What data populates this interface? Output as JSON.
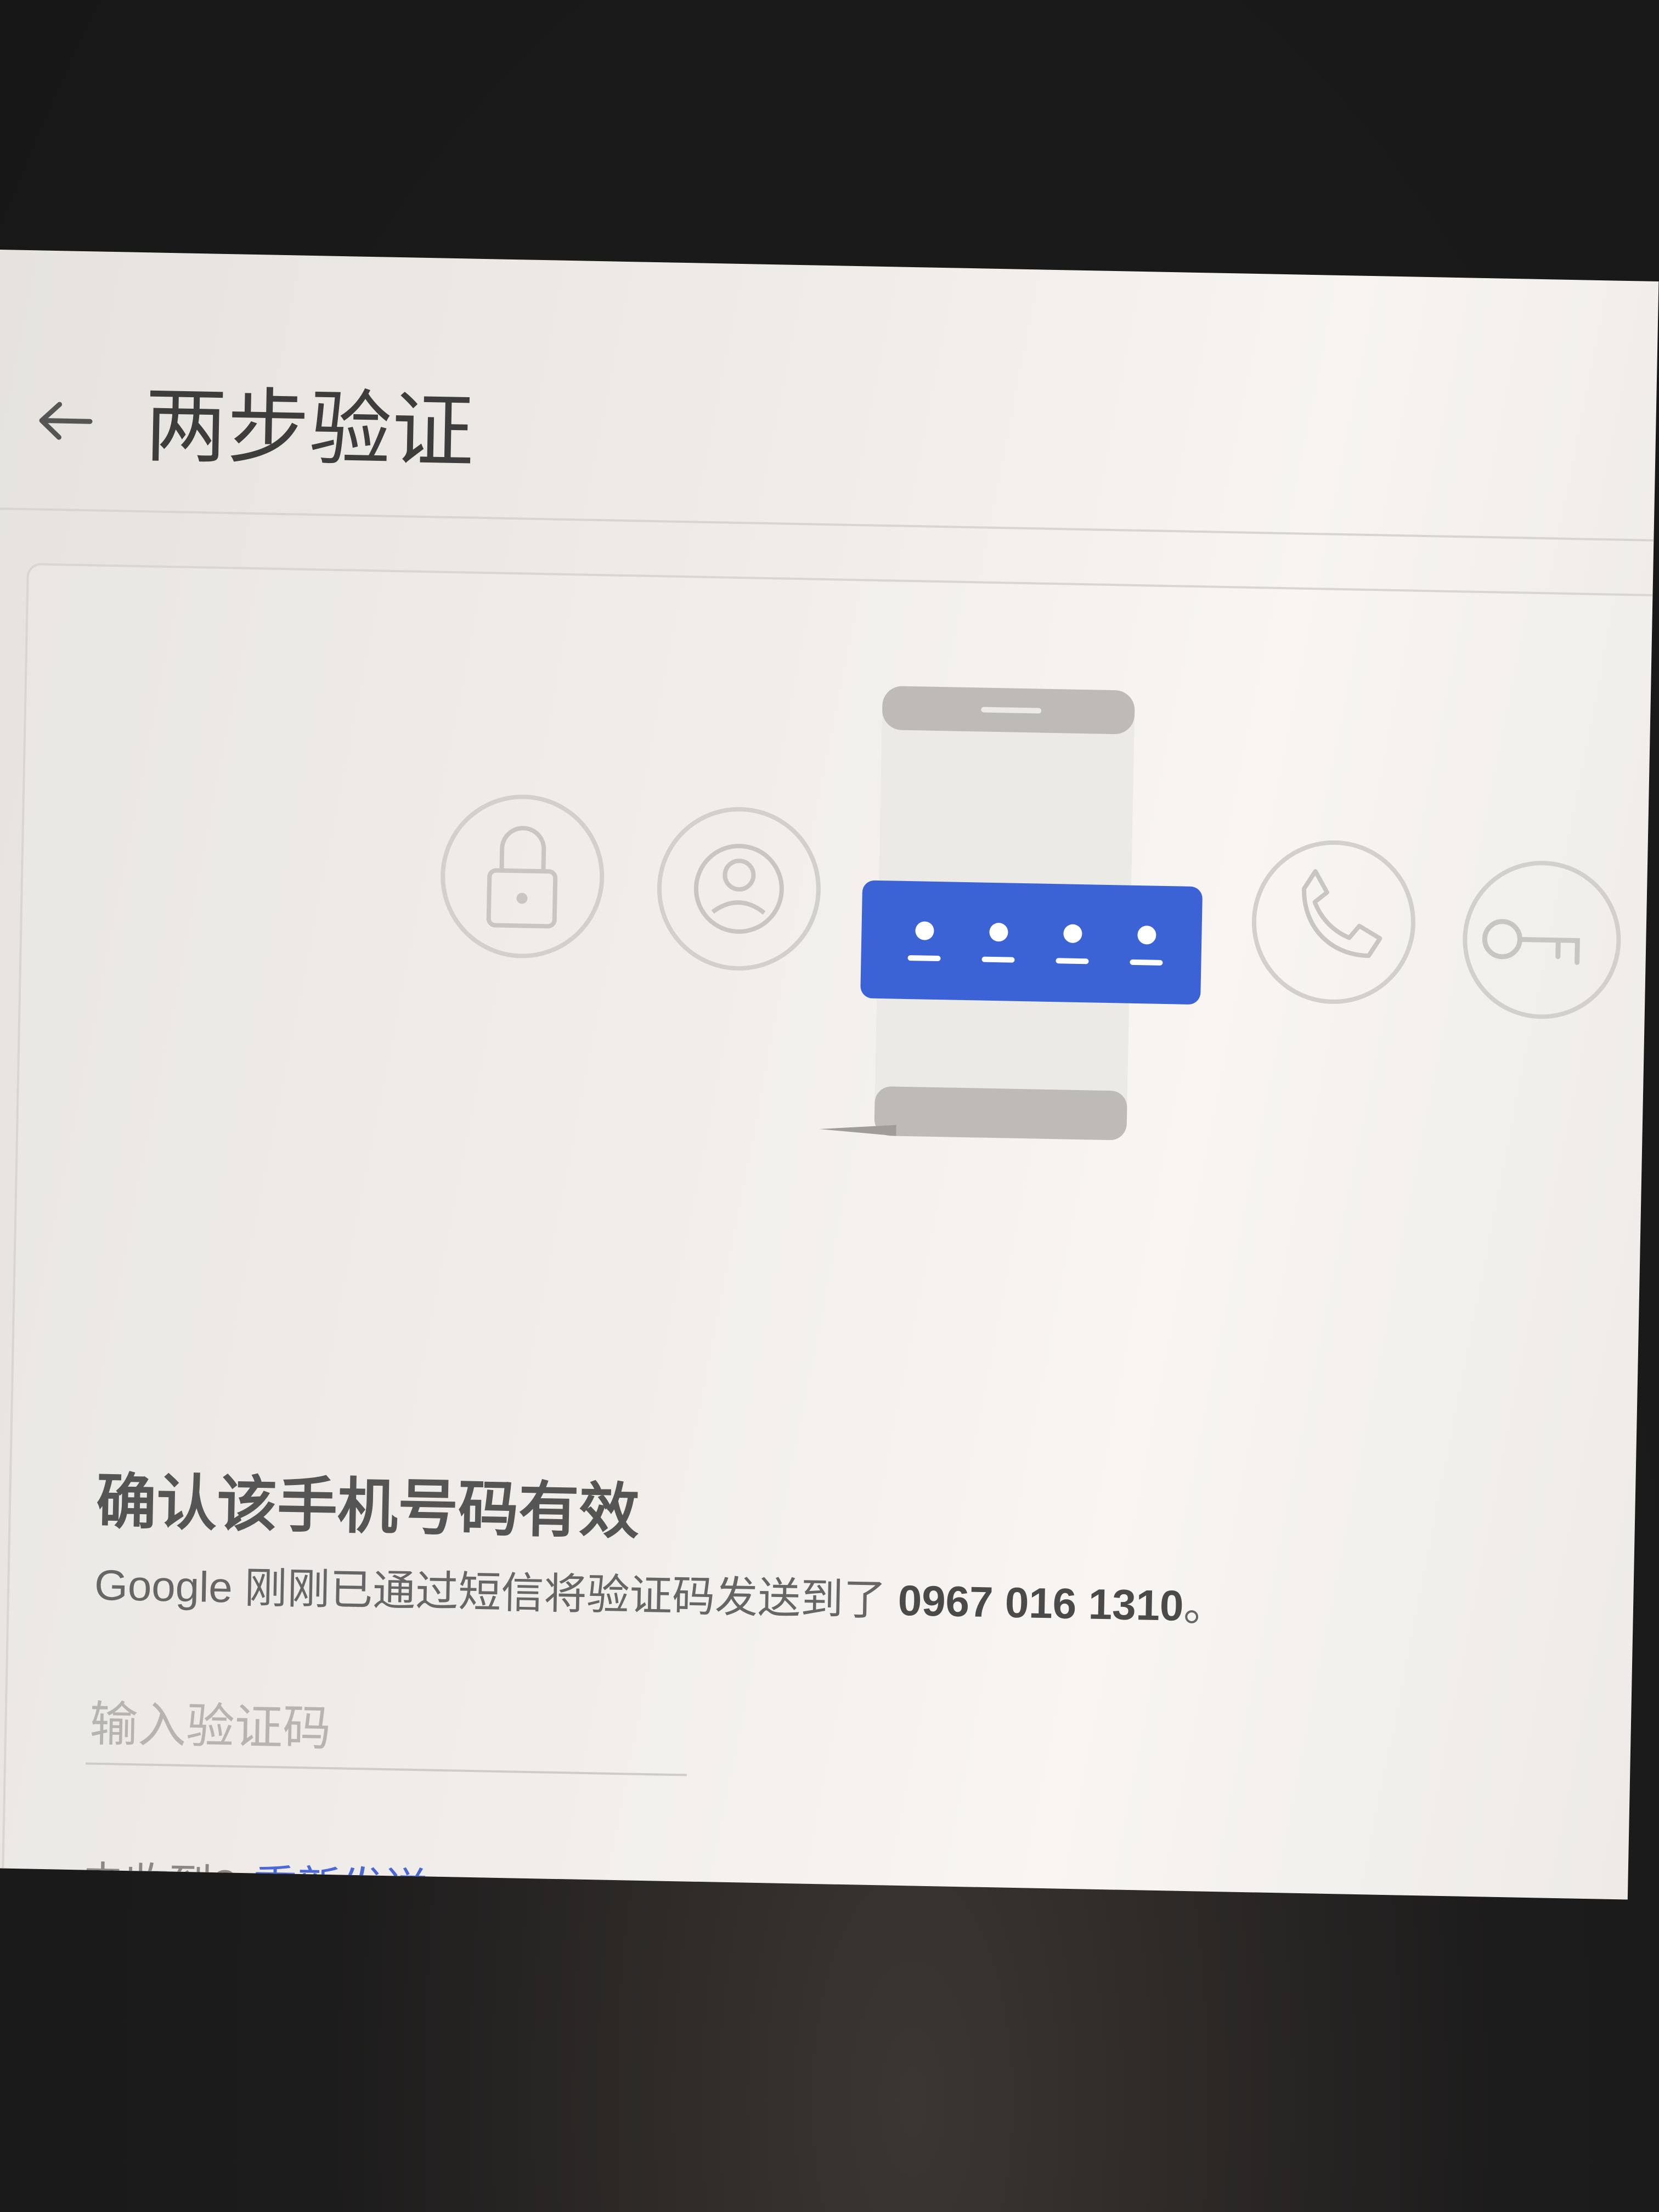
{
  "header": {
    "title": "两步验证",
    "back_icon": "arrow-left-icon"
  },
  "illustration": {
    "icons": [
      "lock-icon",
      "account-icon",
      "phone-icon",
      "call-icon",
      "key-icon"
    ],
    "accent_color": "#3b63d6"
  },
  "main": {
    "heading": "确认该手机号码有效",
    "description_prefix": "Google 刚刚已通过短信将验证码发送到了 ",
    "phone_number": "0967 016 1310",
    "description_suffix": "。",
    "code_input": {
      "placeholder": "输入验证码",
      "value": ""
    },
    "resend": {
      "prompt": "未收到?",
      "link_label": "重新发送"
    }
  }
}
